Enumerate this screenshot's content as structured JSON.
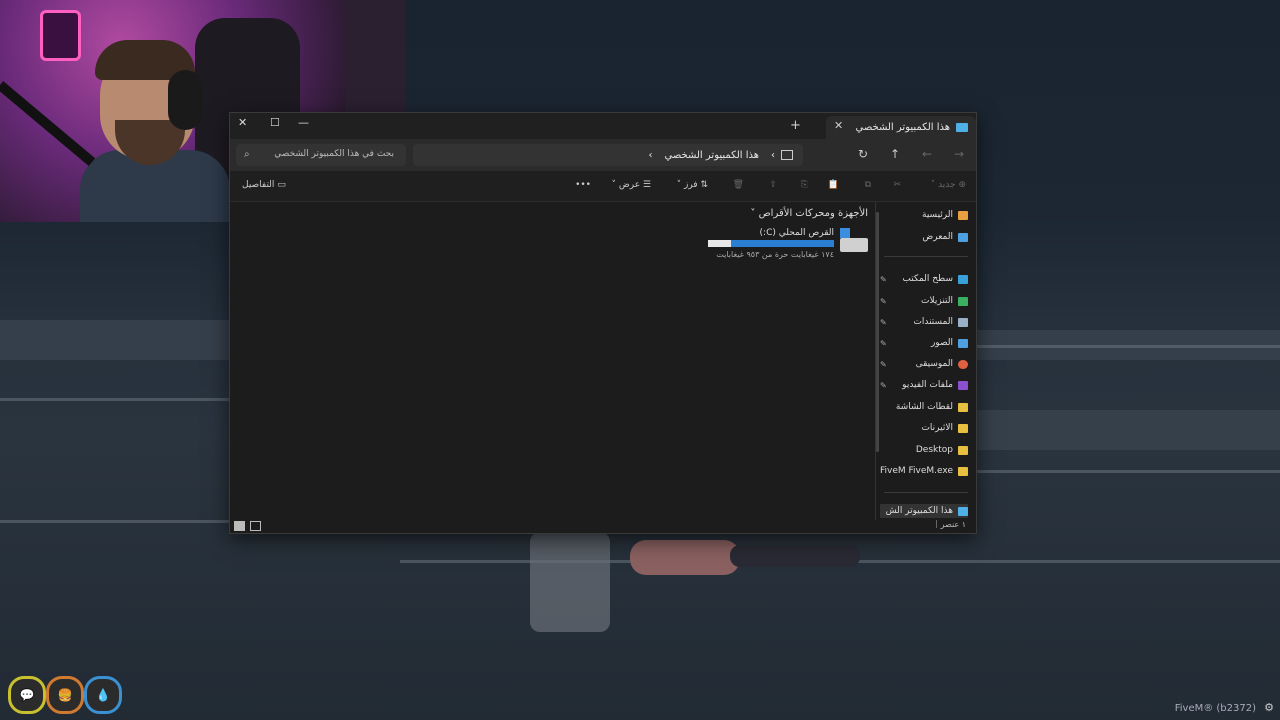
{
  "window": {
    "tab_title": "هذا الكمبيوتر الشخصي",
    "tab_close": "✕",
    "new_tab": "+",
    "minimize": "—",
    "maximize": "☐",
    "close": "✕"
  },
  "address": {
    "path": "هذا الكمبيوتر الشخصي",
    "chevron": "›",
    "expand": "›",
    "search_placeholder": "بحث في هذا الكمبيوتر الشخصي"
  },
  "toolbar": {
    "new_label": "جديد",
    "sort_label": "فرز",
    "view_label": "عرض",
    "more_label": "•••",
    "details_label": "التفاصيل"
  },
  "sidebar": {
    "items": [
      {
        "label": "الرئيسية",
        "color": "#e8a040"
      },
      {
        "label": "المعرض",
        "color": "#4fa0e0"
      },
      {
        "label": "سطح المكتب",
        "color": "#3aa0d8",
        "pinned": true
      },
      {
        "label": "التنزيلات",
        "color": "#3ab060",
        "pinned": true
      },
      {
        "label": "المستندات",
        "color": "#9ab0c8",
        "pinned": true
      },
      {
        "label": "الصور",
        "color": "#4fa0e0",
        "pinned": true
      },
      {
        "label": "الموسيقى",
        "color": "#e06040",
        "pinned": true
      },
      {
        "label": "ملفات الفيديو",
        "color": "#8a50d0",
        "pinned": true
      },
      {
        "label": "لقطات الشاشة",
        "color": "#e8c040"
      },
      {
        "label": "الاثيرنات",
        "color": "#e8c040"
      },
      {
        "label": "Desktop",
        "color": "#e8c040"
      },
      {
        "label": "FiveM FiveM.exe",
        "color": "#e8c040"
      }
    ],
    "this_pc": "هذا الكمبيوتر الش"
  },
  "content": {
    "section_title": "الأجهزة ومحركات الأقراص",
    "drive_name": "القرص المحلي (C:)",
    "drive_free_text": "١٧٤ غيغابايت حرة من ٩٥٣ غيغابايت",
    "drive_used_fraction": 0.82
  },
  "status": {
    "items_count": "١ عنصر"
  },
  "overlay": {
    "watermark": "FiveM® (b2372)",
    "hud_icons": [
      "chat-icon",
      "burger-icon",
      "water-drop-icon"
    ],
    "hud_chat": "💬",
    "hud_food": "🍔",
    "hud_water": "💧"
  }
}
